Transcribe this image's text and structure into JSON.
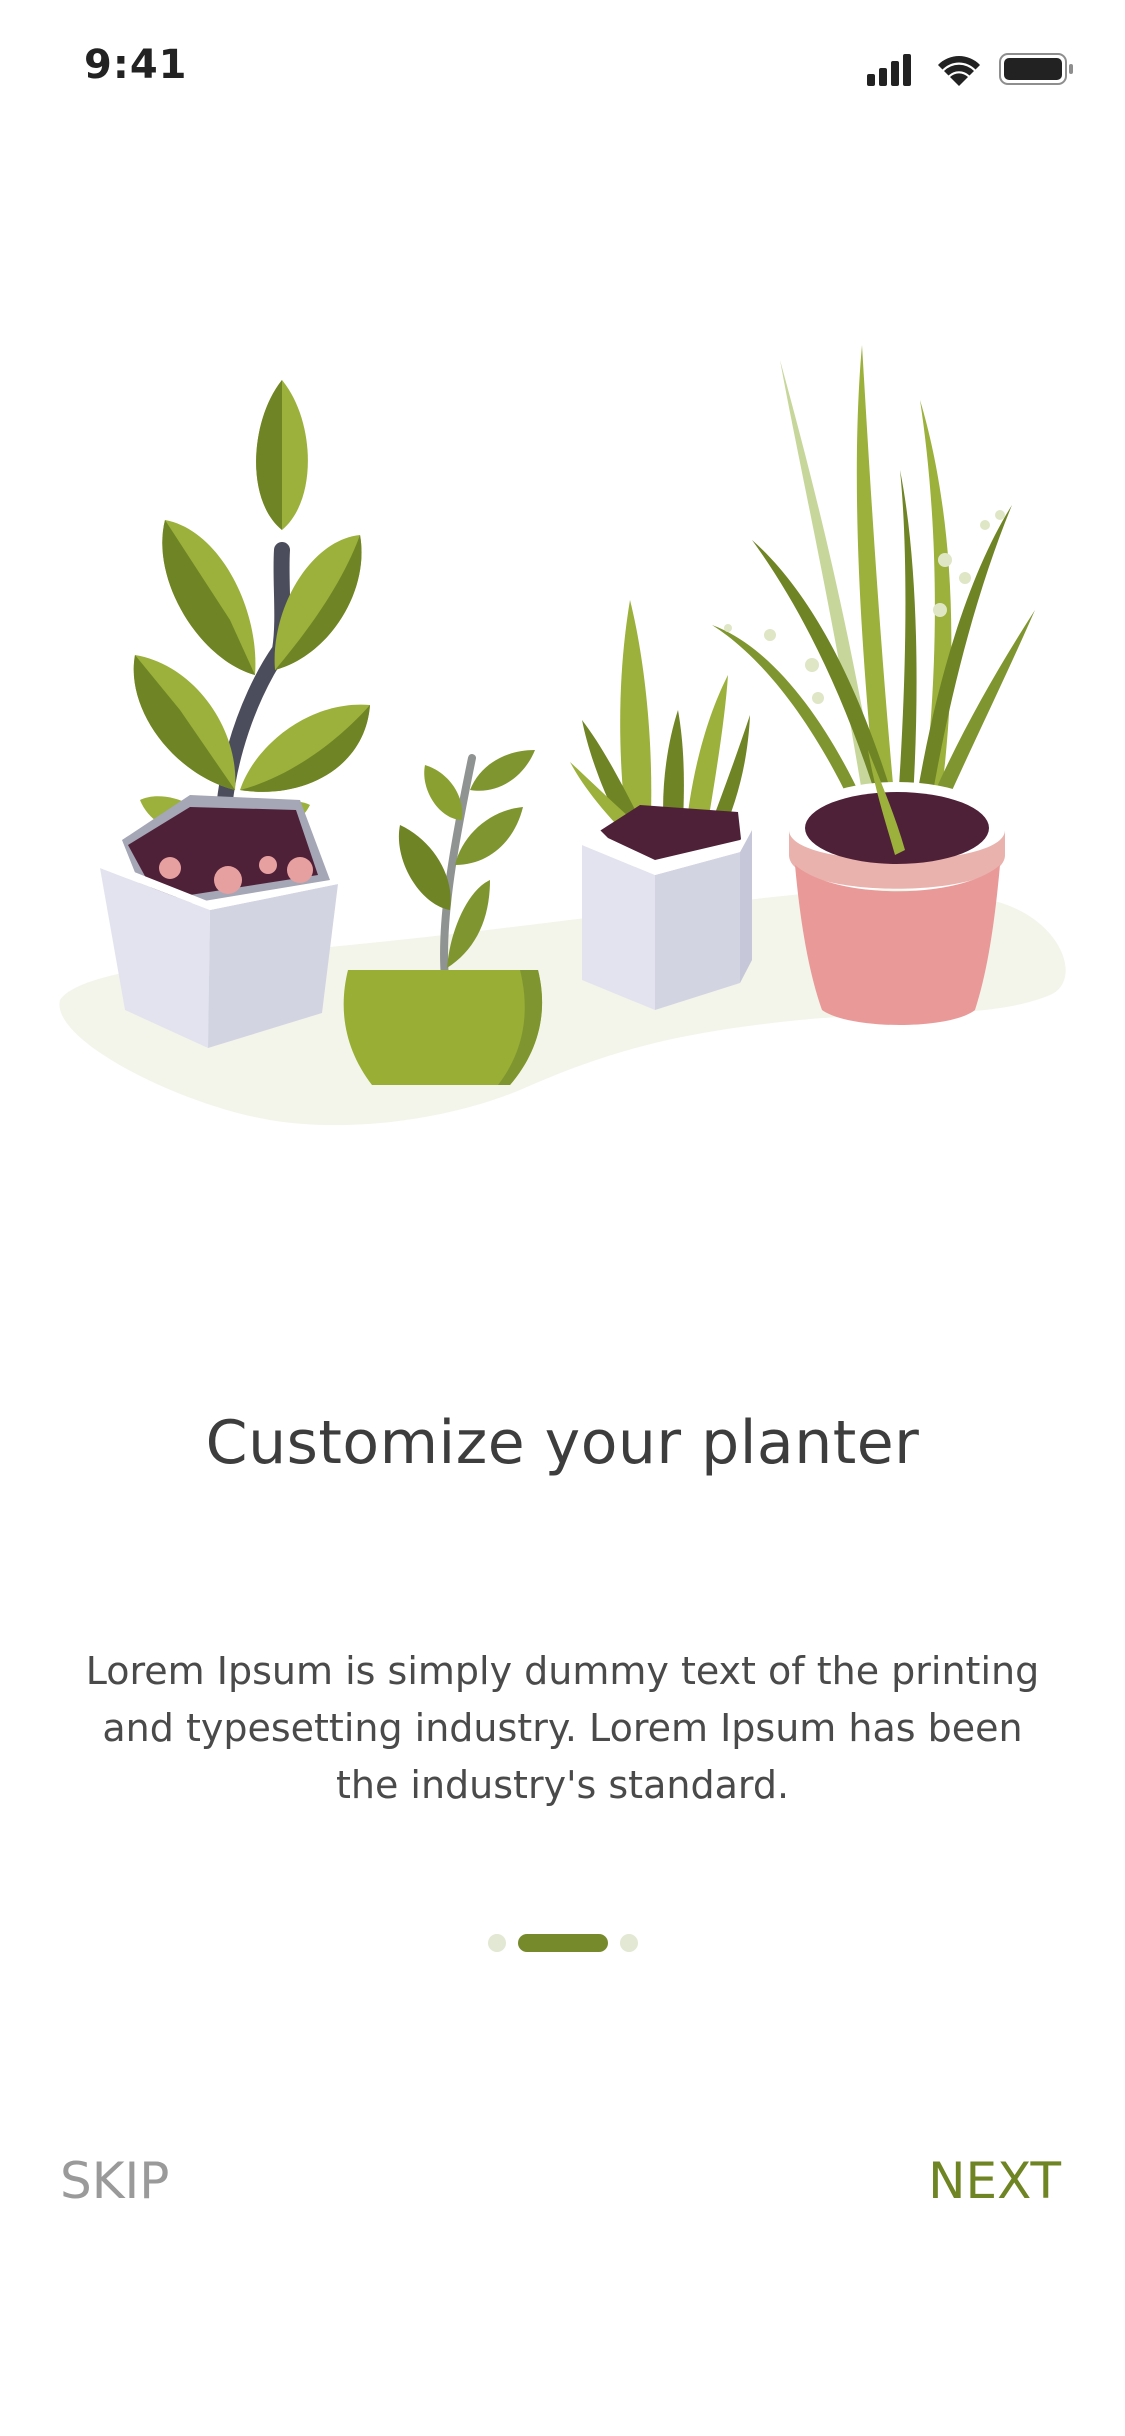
{
  "status_bar": {
    "time": "9:41",
    "icons": [
      "cellular-signal-icon",
      "wifi-icon",
      "battery-icon"
    ]
  },
  "illustration": {
    "name": "potted-plants-illustration",
    "colors": {
      "ground": "#f3f5ea",
      "leaf_light": "#9bb13b",
      "leaf_dark": "#6f8425",
      "soil": "#4f2138",
      "pot_white": "#e2e3ee",
      "pot_green": "#98ae35",
      "pot_pink": "#e99a98"
    }
  },
  "onboarding": {
    "title": "Customize your planter",
    "description": "Lorem Ipsum is simply dummy text of the printing and typesetting industry. Lorem Ipsum has been the industry's standard.",
    "page_indicator": {
      "total": 3,
      "current": 2,
      "active_color": "#768a2c",
      "inactive_color": "#e2e8d3"
    }
  },
  "actions": {
    "skip_label": "SKIP",
    "next_label": "NEXT"
  }
}
